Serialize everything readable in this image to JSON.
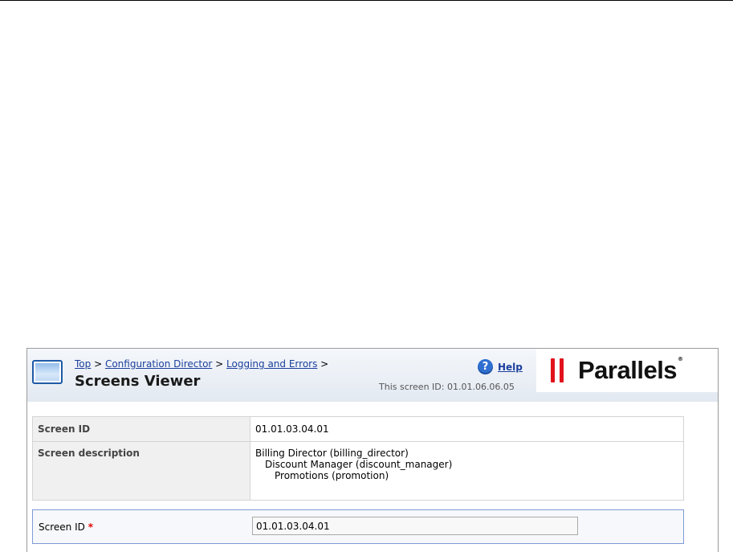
{
  "breadcrumb": {
    "top": "Top",
    "sep1": " > ",
    "config_director": "Configuration Director",
    "sep2": " > ",
    "logging_errors": "Logging and Errors",
    "sep3": " >"
  },
  "header": {
    "title": "Screens Viewer",
    "help_label": "Help",
    "help_icon_glyph": "?",
    "screen_id_text": "This screen ID: 01.01.06.06.05"
  },
  "logo": {
    "word": "Parallels",
    "tm": "®",
    "accent_color": "#e1121b"
  },
  "info_table": {
    "screen_id_label": "Screen ID",
    "screen_id_value": "01.01.03.04.01",
    "description_label": "Screen description",
    "description_lines": [
      "Billing Director (billing_director)",
      "Discount Manager (discount_manager)",
      "Promotions (promotion)"
    ]
  },
  "form": {
    "screen_id_label": "Screen ID",
    "required_mark": "*",
    "screen_id_value": "01.01.03.04.01"
  }
}
